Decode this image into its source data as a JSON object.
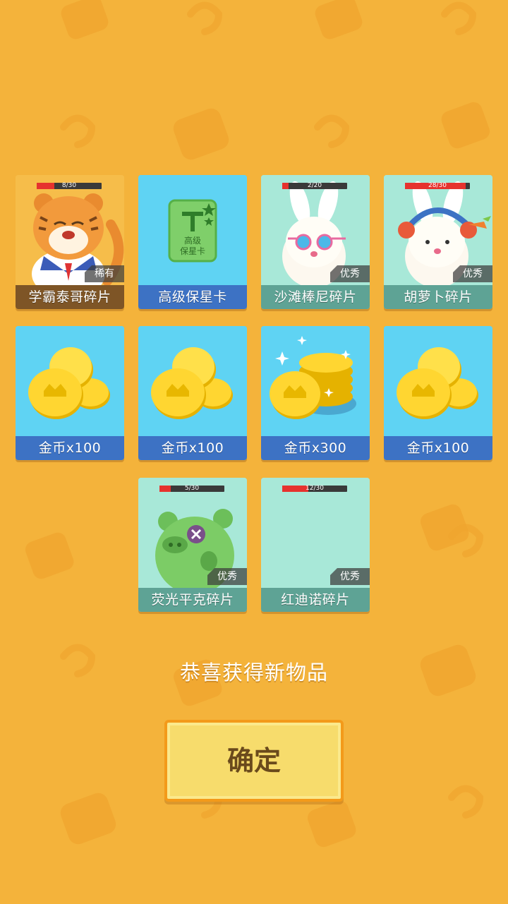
{
  "items": [
    {
      "name": "学霸泰哥碎片",
      "rarity": "稀有",
      "progress": "8/30",
      "fill": 0.27,
      "art": "tiger"
    },
    {
      "name": "高级保星卡",
      "art": "card",
      "card_text": "高级\n保星卡"
    },
    {
      "name": "沙滩棒尼碎片",
      "rarity": "优秀",
      "progress": "2/20",
      "fill": 0.1,
      "art": "bunny-goggles"
    },
    {
      "name": "胡萝卜碎片",
      "rarity": "优秀",
      "progress": "28/30",
      "fill": 0.93,
      "art": "bunny-carrot"
    },
    {
      "name": "金币x100",
      "art": "coins"
    },
    {
      "name": "金币x100",
      "art": "coins"
    },
    {
      "name": "金币x300",
      "art": "coins-stack"
    },
    {
      "name": "金币x100",
      "art": "coins"
    },
    {
      "name": "荧光平克碎片",
      "rarity": "优秀",
      "progress": "5/30",
      "fill": 0.17,
      "art": "pig"
    },
    {
      "name": "红迪诺碎片",
      "rarity": "优秀",
      "progress": "12/30",
      "fill": 0.4,
      "art": "empty"
    }
  ],
  "card_label_line1": "高级",
  "card_label_line2": "保星卡",
  "message": "恭喜获得新物品",
  "confirm_label": "确定",
  "colors": {
    "background": "#f4b33b",
    "fragment_bg": "#a8e8d8",
    "coin_bg": "#5fd3f3",
    "accent": "#f39a1a"
  }
}
